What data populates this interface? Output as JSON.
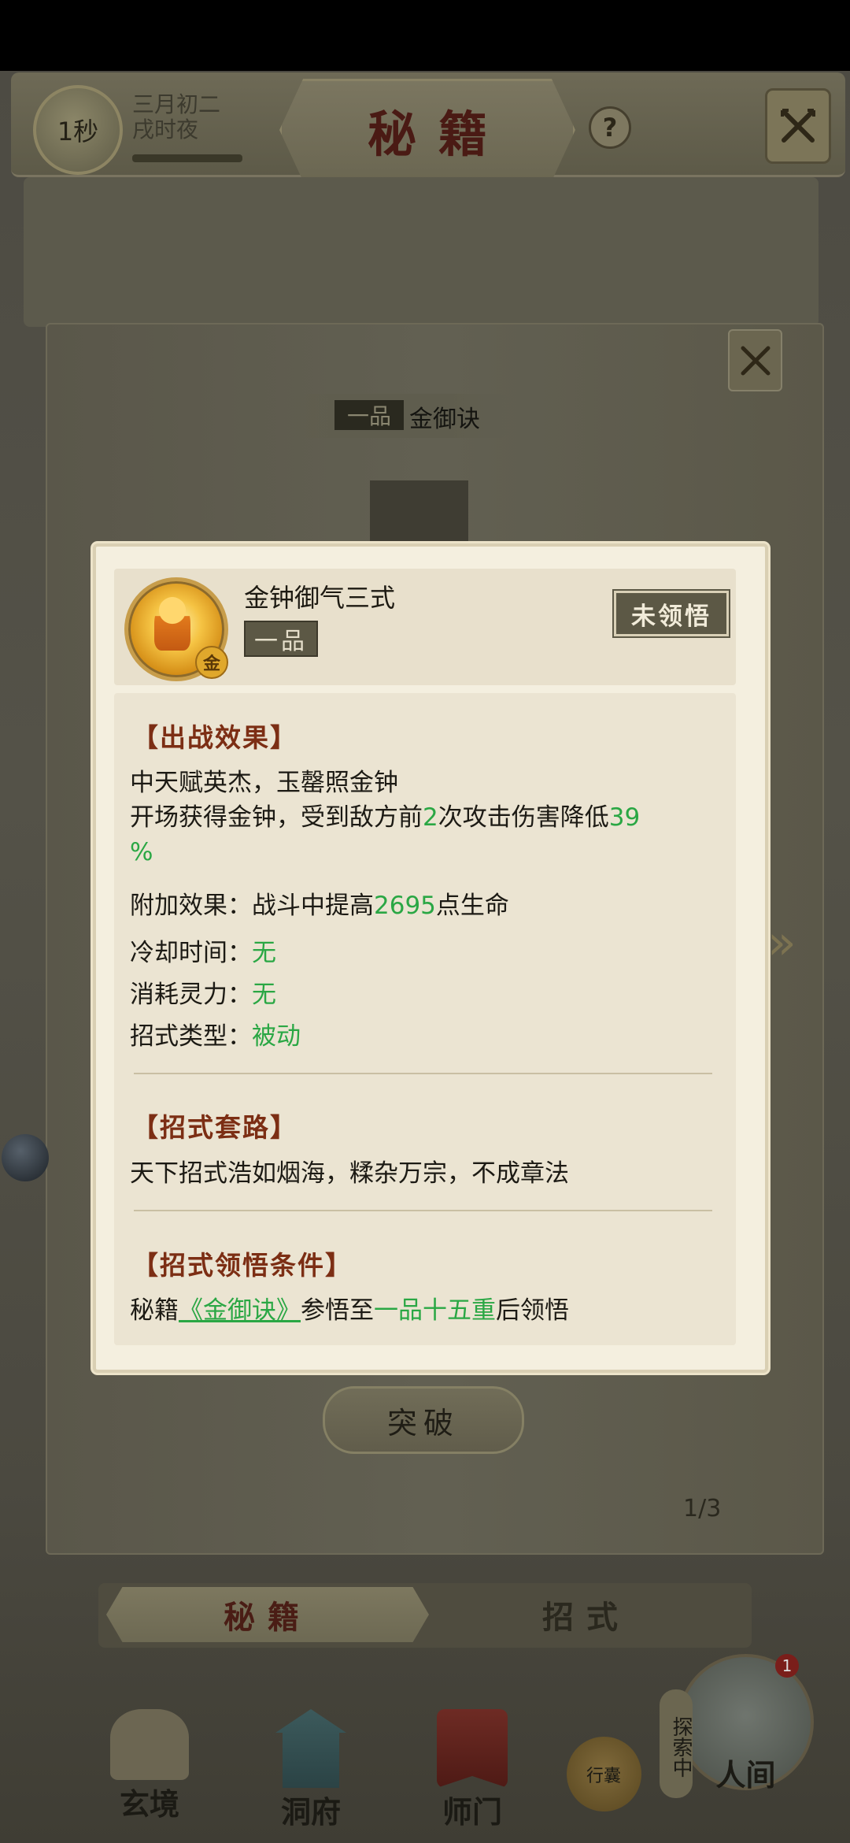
{
  "header": {
    "timer": "1秒",
    "date_line1": "三月初二",
    "date_line2": "戌时夜",
    "title": "秘籍",
    "help": "?"
  },
  "book": {
    "grade": "一品",
    "name": "金御诀",
    "breakthrough_label": "突破",
    "page_indicator": "1/3"
  },
  "tabs": [
    {
      "label": "秘籍",
      "selected": true
    },
    {
      "label": "招式",
      "selected": false
    }
  ],
  "nav": {
    "xuanjing": "玄境",
    "dongfu": "洞府",
    "shimen": "师门",
    "xingnang": "行囊",
    "renjian": "人间",
    "explore_badge": "探索中",
    "notification_count": "1"
  },
  "popup": {
    "skill_name": "金钟御气三式",
    "skill_grade": "一品",
    "element_badge": "金",
    "status": "未领悟",
    "battle_effect": {
      "title": "【出战效果】",
      "line1": "中天赋英杰，玉罄照金钟",
      "line2_prefix": "开场获得金钟，受到敌方前",
      "line2_count": "2",
      "line2_mid": "次攻击伤害降低",
      "line2_value": "39",
      "line2_suffix": "%",
      "extra_label": "附加效果：战斗中提高",
      "extra_value": "2695",
      "extra_suffix": "点生命",
      "cooldown_label": "冷却时间：",
      "cooldown_value": "无",
      "cost_label": "消耗灵力：",
      "cost_value": "无",
      "type_label": "招式类型：",
      "type_value": "被动"
    },
    "routine": {
      "title": "【招式套路】",
      "text": "天下招式浩如烟海，糅杂万宗，不成章法"
    },
    "condition": {
      "title": "【招式领悟条件】",
      "prefix": "秘籍",
      "link": "《金御诀》",
      "mid": "参悟至",
      "level": "一品十五重",
      "suffix": "后领悟"
    }
  },
  "colors": {
    "highlight_green": "#2aa744",
    "section_title": "#7c2e14",
    "popup_bg": "#f4efdf"
  }
}
